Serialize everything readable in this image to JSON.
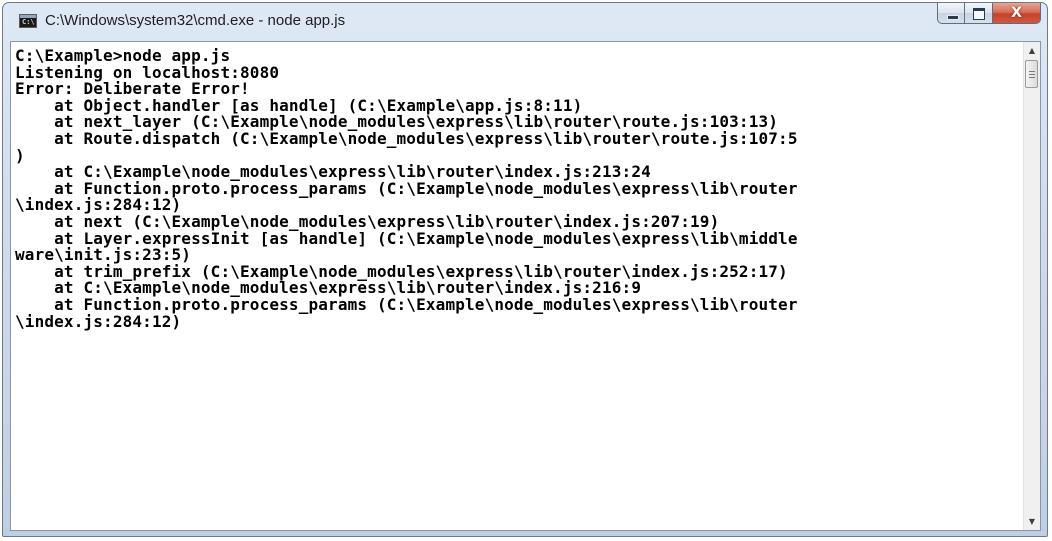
{
  "window": {
    "title": "C:\\Windows\\system32\\cmd.exe - node  app.js",
    "icon": "cmd-prompt-icon",
    "icon_text": "C:\\"
  },
  "caption_buttons": {
    "minimize": "minimize-icon",
    "maximize": "maximize-icon",
    "close": "close-icon",
    "close_glyph": "X"
  },
  "console": {
    "lines": [
      "C:\\Example>node app.js",
      "Listening on localhost:8080",
      "Error: Deliberate Error!",
      "    at Object.handler [as handle] (C:\\Example\\app.js:8:11)",
      "    at next_layer (C:\\Example\\node_modules\\express\\lib\\router\\route.js:103:13)",
      "    at Route.dispatch (C:\\Example\\node_modules\\express\\lib\\router\\route.js:107:5",
      ")",
      "    at C:\\Example\\node_modules\\express\\lib\\router\\index.js:213:24",
      "    at Function.proto.process_params (C:\\Example\\node_modules\\express\\lib\\router",
      "\\index.js:284:12)",
      "    at next (C:\\Example\\node_modules\\express\\lib\\router\\index.js:207:19)",
      "    at Layer.expressInit [as handle] (C:\\Example\\node_modules\\express\\lib\\middle",
      "ware\\init.js:23:5)",
      "    at trim_prefix (C:\\Example\\node_modules\\express\\lib\\router\\index.js:252:17)",
      "    at C:\\Example\\node_modules\\express\\lib\\router\\index.js:216:9",
      "    at Function.proto.process_params (C:\\Example\\node_modules\\express\\lib\\router",
      "\\index.js:284:12)"
    ]
  },
  "scrollbar": {
    "up_arrow": "▲",
    "down_arrow": "▼"
  },
  "colors": {
    "console_background": "#ffffff",
    "console_text": "#000000",
    "close_button": "#c7422a"
  }
}
